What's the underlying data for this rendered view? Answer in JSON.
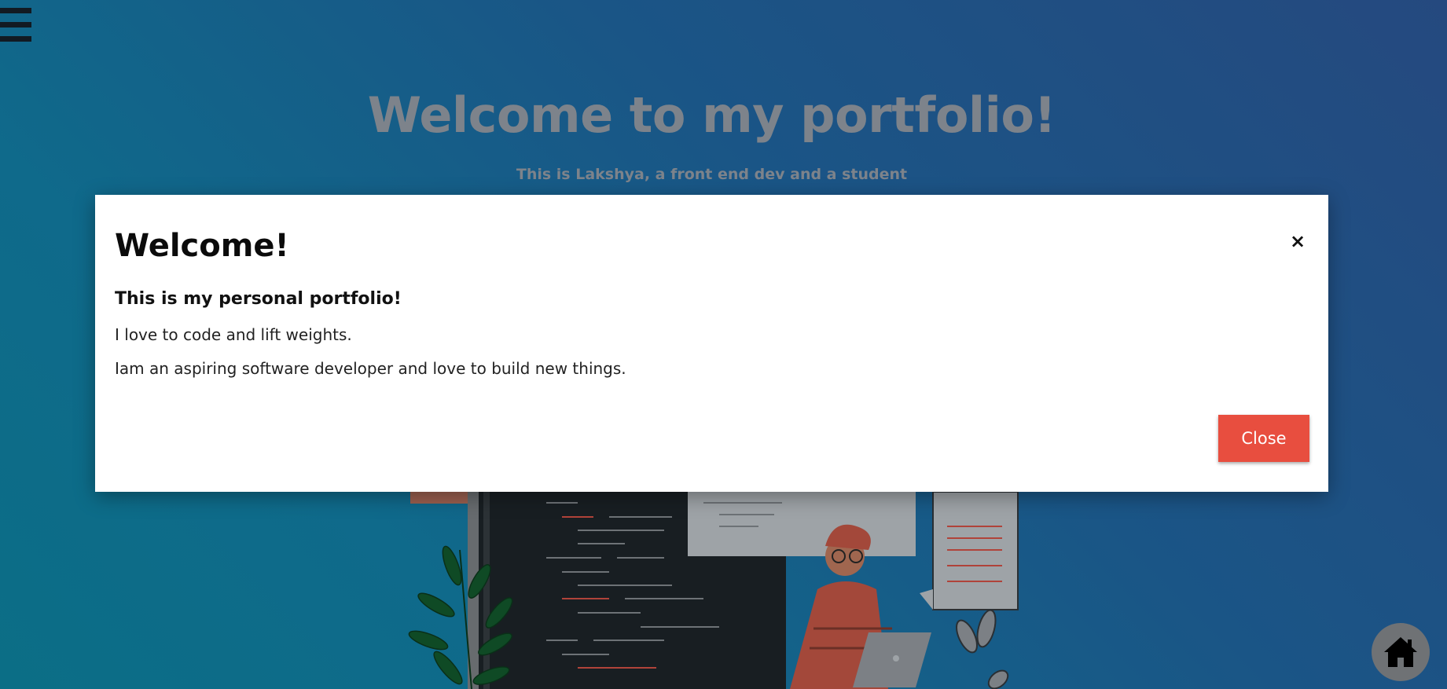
{
  "nav": {
    "menu_icon": "hamburger-menu-icon"
  },
  "hero": {
    "title": "Welcome to my portfolio!",
    "subtitle": "This is Lakshya, a front end dev and a student"
  },
  "modal": {
    "title": "Welcome!",
    "close_icon_glyph": "×",
    "subtitle": "This is my personal portfolio!",
    "paragraphs": [
      "I love to code and lift weights.",
      "Iam an aspiring software developer and love to build new things."
    ],
    "close_label": "Close"
  },
  "home": {
    "icon": "home-icon"
  },
  "colors": {
    "close_button": "#e84e3f",
    "bg_top_right": "#25497f",
    "bg_bottom_left": "#0b6e86",
    "hero_text": "#7d838b"
  }
}
